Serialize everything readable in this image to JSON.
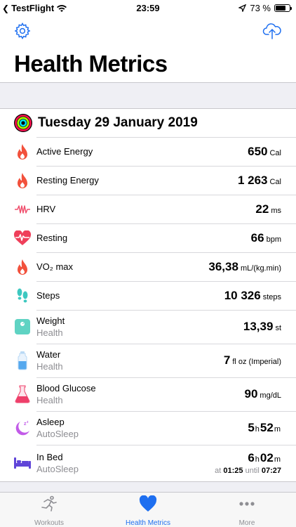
{
  "status_bar": {
    "back_app": "TestFlight",
    "time": "23:59",
    "battery": "73 %",
    "battery_level": 0.73
  },
  "navbar": {
    "title": "Health Metrics",
    "left_icon": "gear-icon",
    "right_icon": "cloud-upload-icon"
  },
  "date_header": {
    "icon": "activity-rings-icon",
    "text": "Tuesday 29 January 2019"
  },
  "metrics": [
    {
      "label": "Active Energy",
      "value": "650",
      "unit": "Cal",
      "icon": "flame-icon"
    },
    {
      "label": "Resting Energy",
      "value": "1 263",
      "unit": "Cal",
      "icon": "flame-icon"
    },
    {
      "label": "HRV",
      "value": "22",
      "unit": "ms",
      "icon": "hrv-waveform-icon"
    },
    {
      "label": "Resting",
      "value": "66",
      "unit": "bpm",
      "icon": "heart-pulse-icon"
    },
    {
      "label": "VO₂ max",
      "value": "36,38",
      "unit": "mL/(kg.min)",
      "icon": "flame-icon"
    },
    {
      "label": "Steps",
      "value": "10 326",
      "unit": "steps",
      "icon": "footprints-icon"
    },
    {
      "label": "Weight",
      "source": "Health",
      "value": "13,39",
      "unit": "st",
      "icon": "scale-icon"
    },
    {
      "label": "Water",
      "source": "Health",
      "value": "7",
      "unit": "fl oz (Imperial)",
      "icon": "water-bottle-icon"
    },
    {
      "label": "Blood Glucose",
      "source": "Health",
      "value": "90",
      "unit": "mg/dL",
      "icon": "flask-icon"
    }
  ],
  "sleep": {
    "asleep": {
      "label": "Asleep",
      "source": "AutoSleep",
      "hours": "5",
      "h_unit": "h",
      "minutes": "52",
      "m_unit": "m",
      "icon": "moon-icon"
    },
    "in_bed": {
      "label": "In Bed",
      "source": "AutoSleep",
      "hours": "6",
      "h_unit": "h",
      "minutes": "02",
      "m_unit": "m",
      "at_label": "at",
      "start": "01:25",
      "until_label": "until",
      "end": "07:27",
      "icon": "bed-icon"
    }
  },
  "tabs": [
    {
      "label": "Workouts",
      "icon": "running-figure-icon",
      "active": false
    },
    {
      "label": "Health Metrics",
      "icon": "heart-icon",
      "active": true
    },
    {
      "label": "More",
      "icon": "ellipsis-icon",
      "active": false
    }
  ],
  "colors": {
    "accent": "#1e6ff0",
    "flame": "#f2513c",
    "hrv": "#f0506e",
    "steps": "#3dc8c0",
    "weight": "#5fd3c3",
    "water": "#55a8ee",
    "glucose": "#ee3f6a",
    "sleep": "#c25be8",
    "bed": "#6045d8"
  }
}
